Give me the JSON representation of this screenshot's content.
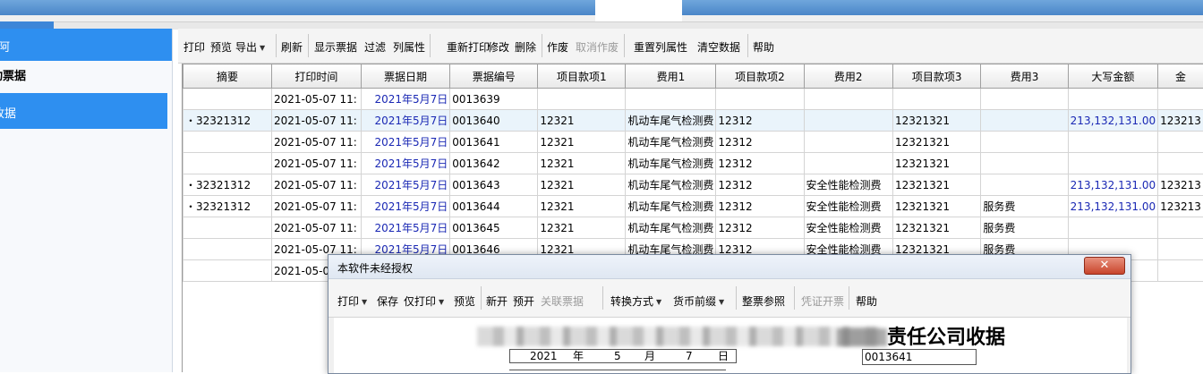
{
  "sidebar": {
    "header": "阿",
    "group": "动票据",
    "active_item": "收据"
  },
  "toolbar": {
    "items": [
      {
        "label": "打印",
        "caret": false,
        "disabled": false
      },
      {
        "label": "预览",
        "caret": false,
        "disabled": false
      },
      {
        "label": "导出",
        "caret": true,
        "disabled": false
      },
      {
        "label": "刷新",
        "caret": false,
        "disabled": false
      },
      {
        "label": "显示票据",
        "caret": false,
        "disabled": false
      },
      {
        "label": "过滤",
        "caret": false,
        "disabled": false
      },
      {
        "label": "列属性",
        "caret": false,
        "disabled": false
      },
      {
        "label": "重新打印",
        "caret": false,
        "disabled": false
      },
      {
        "label": "修改",
        "caret": false,
        "disabled": false
      },
      {
        "label": "删除",
        "caret": false,
        "disabled": false
      },
      {
        "label": "作废",
        "caret": false,
        "disabled": false
      },
      {
        "label": "取消作废",
        "caret": false,
        "disabled": true
      },
      {
        "label": "重置列属性",
        "caret": false,
        "disabled": false
      },
      {
        "label": "清空数据",
        "caret": false,
        "disabled": false
      },
      {
        "label": "帮助",
        "caret": false,
        "disabled": false
      }
    ]
  },
  "grid": {
    "columns": [
      "摘要",
      "打印时间",
      "票据日期",
      "票据编号",
      "项目款项1",
      "费用1",
      "项目款项2",
      "费用2",
      "项目款项3",
      "费用3",
      "大写金额",
      "金"
    ],
    "rows": [
      [
        "",
        "2021-05-07 11:",
        "2021年5月7日",
        "0013639",
        "",
        "",
        "",
        "",
        "",
        "",
        "",
        ""
      ],
      [
        "・32321312",
        "2021-05-07 11:",
        "2021年5月7日",
        "0013640",
        "12321",
        "机动车尾气检测费",
        "12312",
        "",
        "12321321",
        "",
        "213,132,131.00",
        "123213"
      ],
      [
        "",
        "2021-05-07 11:",
        "2021年5月7日",
        "0013641",
        "12321",
        "机动车尾气检测费",
        "12312",
        "",
        "12321321",
        "",
        "",
        ""
      ],
      [
        "",
        "2021-05-07 11:",
        "2021年5月7日",
        "0013642",
        "12321",
        "机动车尾气检测费",
        "12312",
        "",
        "12321321",
        "",
        "",
        ""
      ],
      [
        "・32321312",
        "2021-05-07 11:",
        "2021年5月7日",
        "0013643",
        "12321",
        "机动车尾气检测费",
        "12312",
        "安全性能检测费",
        "12321321",
        "",
        "213,132,131.00",
        "123213"
      ],
      [
        "・32321312",
        "2021-05-07 11:",
        "2021年5月7日",
        "0013644",
        "12321",
        "机动车尾气检测费",
        "12312",
        "安全性能检测费",
        "12321321",
        "服务费",
        "213,132,131.00",
        "123213"
      ],
      [
        "",
        "2021-05-07 11:",
        "2021年5月7日",
        "0013645",
        "12321",
        "机动车尾气检测费",
        "12312",
        "安全性能检测费",
        "12321321",
        "服务费",
        "",
        ""
      ],
      [
        "",
        "2021-05-07 11:",
        "2021年5月7日",
        "0013646",
        "12321",
        "机动车尾气检测费",
        "12312",
        "安全性能检测费",
        "12321321",
        "服务费",
        "",
        ""
      ],
      [
        "",
        "2021-05-0",
        "",
        "",
        "",
        "",
        "",
        "",
        "",
        "",
        "",
        ""
      ]
    ],
    "selected_row": 1
  },
  "modal": {
    "title": "本软件未经授权",
    "close_icon": "close-icon",
    "toolbar": [
      {
        "label": "打印",
        "caret": true,
        "disabled": false
      },
      {
        "label": "保存",
        "caret": false,
        "disabled": false
      },
      {
        "label": "仅打印",
        "caret": true,
        "disabled": false
      },
      {
        "label": "预览",
        "caret": false,
        "disabled": false
      },
      {
        "label": "新开",
        "caret": false,
        "disabled": false
      },
      {
        "label": "预开",
        "caret": false,
        "disabled": false
      },
      {
        "label": "关联票据",
        "caret": false,
        "disabled": true
      },
      {
        "label": "转换方式",
        "caret": true,
        "disabled": false
      },
      {
        "label": "货币前缀",
        "caret": true,
        "disabled": false
      },
      {
        "label": "整票参照",
        "caret": false,
        "disabled": false
      },
      {
        "label": "凭证开票",
        "caret": false,
        "disabled": true
      },
      {
        "label": "帮助",
        "caret": false,
        "disabled": false
      }
    ],
    "receipt": {
      "heading": "责任公司收据",
      "year": "2021",
      "year_unit": "年",
      "month": "5",
      "month_unit": "月",
      "day": "7",
      "day_unit": "日",
      "number": "0013641"
    }
  },
  "colors": {
    "accent": "#2e8ff0",
    "date_text": "#1a28b4",
    "selected_row": "#eaf4fb"
  }
}
